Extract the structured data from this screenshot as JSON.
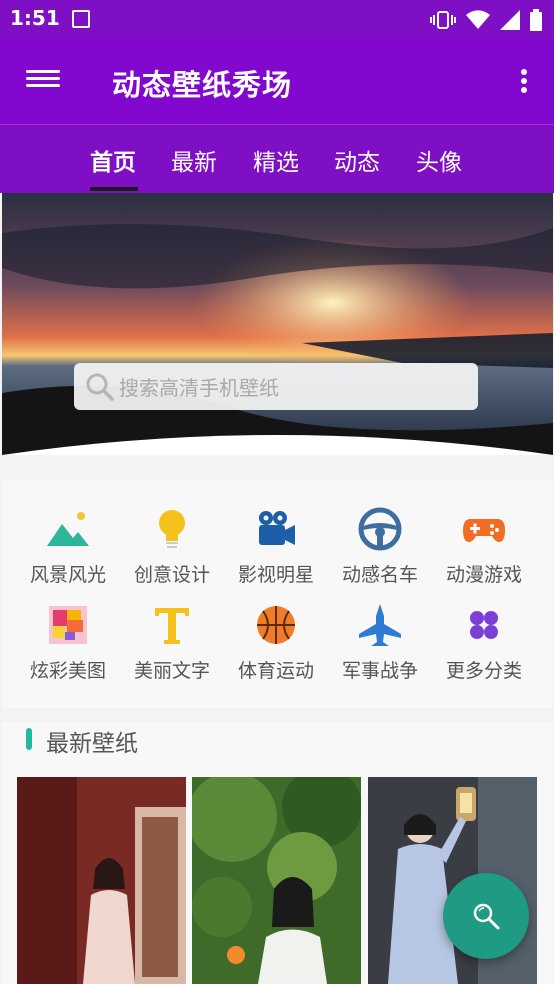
{
  "status_bar": {
    "time": "1:51"
  },
  "app_bar": {
    "title": "动态壁纸秀场"
  },
  "tabs": [
    {
      "label": "首页",
      "active": true
    },
    {
      "label": "最新",
      "active": false
    },
    {
      "label": "精选",
      "active": false
    },
    {
      "label": "动态",
      "active": false
    },
    {
      "label": "头像",
      "active": false
    }
  ],
  "search": {
    "placeholder": "搜索高清手机壁纸"
  },
  "categories": [
    {
      "label": "风景风光",
      "icon": "landscape-icon"
    },
    {
      "label": "创意设计",
      "icon": "lightbulb-icon"
    },
    {
      "label": "影视明星",
      "icon": "video-camera-icon"
    },
    {
      "label": "动感名车",
      "icon": "steering-wheel-icon"
    },
    {
      "label": "动漫游戏",
      "icon": "gamepad-icon"
    },
    {
      "label": "炫彩美图",
      "icon": "color-palette-icon"
    },
    {
      "label": "美丽文字",
      "icon": "text-t-icon"
    },
    {
      "label": "体育运动",
      "icon": "basketball-icon"
    },
    {
      "label": "军事战争",
      "icon": "fighter-jet-icon"
    },
    {
      "label": "更多分类",
      "icon": "four-dots-icon"
    }
  ],
  "latest": {
    "title": "最新壁纸"
  },
  "colors": {
    "primary": "#8208cf",
    "accent": "#1fbb9c",
    "fab": "#1e9b82"
  }
}
